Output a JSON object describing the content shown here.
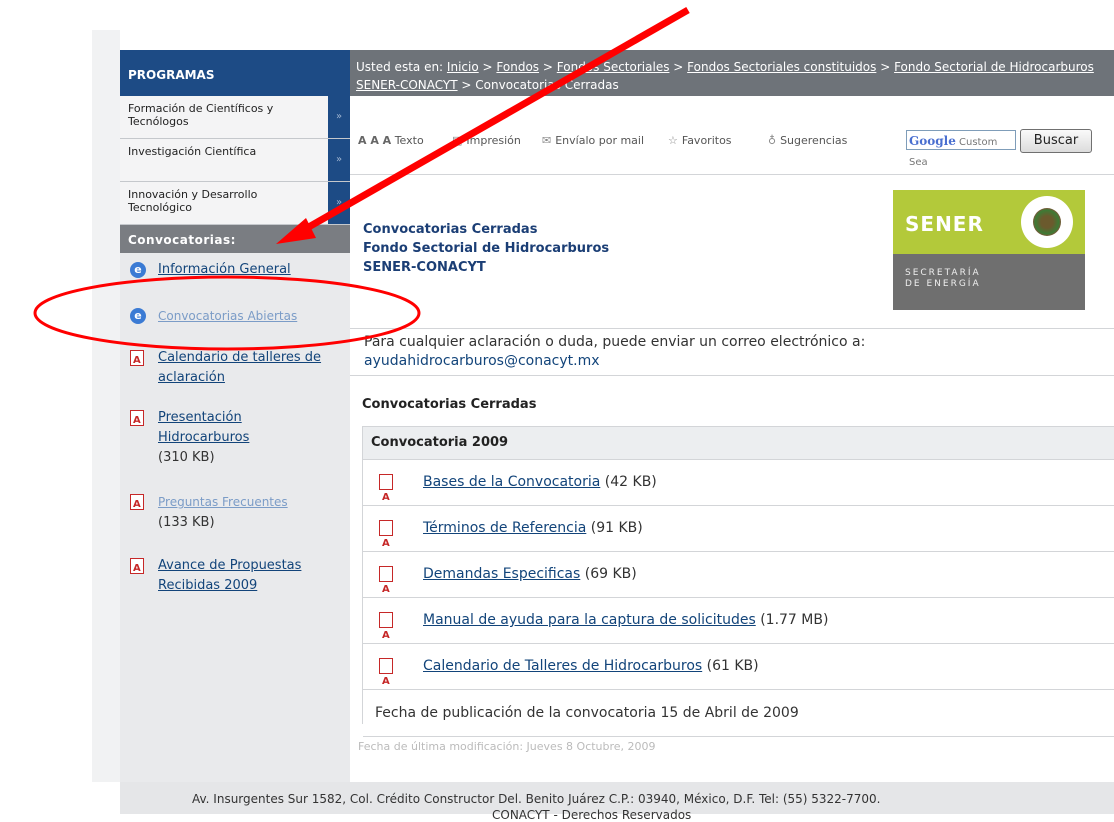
{
  "sidebar": {
    "programs_title": "PROGRAMAS",
    "programs": [
      {
        "label": "Formación de Científicos y Tecnólogos"
      },
      {
        "label": "Investigación Científica"
      },
      {
        "label": "Innovación y Desarrollo Tecnológico"
      }
    ],
    "arrow_glyph": "»",
    "convocatorias_title": "Convocatorias:",
    "links": [
      {
        "text": "Información General"
      },
      {
        "text": "Convocatorias Abiertas"
      },
      {
        "text": "Calendario de talleres de aclaración"
      },
      {
        "text": "Presentación Hidrocarburos",
        "size": "(310 KB)"
      },
      {
        "text": "Preguntas Frecuentes",
        "size": "(133 KB)"
      },
      {
        "text": "Avance de Propuestas Recibidas 2009"
      }
    ]
  },
  "breadcrumb": {
    "prefix": "Usted esta en:",
    "items": [
      "Inicio",
      "Fondos",
      "Fondos Sectoriales",
      "Fondos Sectoriales constituidos",
      "Fondo Sectorial de Hidrocarburos SENER-CONACYT"
    ],
    "current": "Convocatorias Cerradas",
    "sep": ">"
  },
  "toolbar": {
    "text_size_letters": "A A A",
    "text_label": "Texto",
    "print": "Impresión",
    "mail": "Envíalo por mail",
    "favorites": "Favoritos",
    "suggestions": "Sugerencias",
    "search_google": "Google",
    "search_placeholder": "Custom Sea",
    "search_button": "Buscar"
  },
  "page_header": {
    "line1": "Convocatorias Cerradas",
    "line2": "Fondo Sectorial de Hidrocarburos",
    "line3": "SENER-CONACYT"
  },
  "logo": {
    "name": "SENER",
    "line1": "SECRETARÍA",
    "line2": "DE ENERGÍA"
  },
  "info": {
    "text": "Para cualquier aclaración o duda, puede enviar un correo electrónico a:",
    "email": "ayudahidrocarburos@conacyt.mx"
  },
  "section_label": "Convocatorias Cerradas",
  "table": {
    "header": "Convocatoria 2009",
    "rows": [
      {
        "link": "Bases de la Convocatoria",
        "size": "(42 KB)"
      },
      {
        "link": "Términos de Referencia",
        "size": "(91 KB)"
      },
      {
        "link": "Demandas Especificas",
        "size": "(69 KB)"
      },
      {
        "link": "Manual de ayuda para la captura de solicitudes",
        "size": "(1.77 MB)"
      },
      {
        "link": "Calendario de Talleres de Hidrocarburos",
        "size": "(61 KB)"
      }
    ],
    "footer": "Fecha de publicación de la convocatoria 15 de Abril de 2009"
  },
  "modified": "Fecha de última modificación: Jueves 8 Octubre, 2009",
  "footer": {
    "line1": "Av. Insurgentes Sur 1582, Col. Crédito Constructor Del. Benito Juárez C.P.: 03940, México, D.F. Tel: (55) 5322-7700.",
    "line2": "CONACYT - Derechos Reservados"
  },
  "colors": {
    "nav_blue": "#1d4b85",
    "gray_bar": "#6e7379",
    "annotation_red": "#ff0000",
    "sener_green": "#b3c93a"
  }
}
